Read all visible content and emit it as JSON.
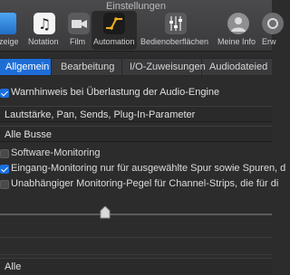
{
  "window": {
    "title": "Einstellungen"
  },
  "toolbar": {
    "items": [
      {
        "label": "Anzeige",
        "icon": "display-icon"
      },
      {
        "label": "Notation",
        "icon": "notation-icon"
      },
      {
        "label": "Film",
        "icon": "film-icon"
      },
      {
        "label": "Automation",
        "icon": "automation-icon",
        "selected": true
      },
      {
        "label": "Bedienoberflächen",
        "icon": "control-surfaces-icon"
      },
      {
        "label": "Meine Info",
        "icon": "my-info-icon"
      },
      {
        "label": "Erw",
        "icon": "advanced-icon"
      }
    ]
  },
  "tabs": [
    {
      "label": "Allgemein",
      "selected": true
    },
    {
      "label": "Bearbeitung"
    },
    {
      "label": "I/O-Zuweisungen"
    },
    {
      "label": "Audiodateied"
    }
  ],
  "general": {
    "overload_warning": {
      "label": "Warnhinweis bei Überlastung der Audio-Engine",
      "checked": true
    }
  },
  "sections": {
    "plugin_params": "Lautstärke, Pan, Sends, Plug-In-Parameter",
    "all_busses": "Alle Busse",
    "alle": "Alle"
  },
  "monitoring": {
    "software": {
      "label": "Software-Monitoring",
      "checked": false
    },
    "input": {
      "label": "Eingang-Monitoring nur für ausgewählte Spur sowie Spuren, d",
      "checked": true
    },
    "independent": {
      "label": "Unabhängiger Monitoring-Pegel für Channel-Strips, die für di",
      "checked": false
    }
  },
  "colors": {
    "accent": "#1e6dd6",
    "background": "#2c2c2d"
  }
}
